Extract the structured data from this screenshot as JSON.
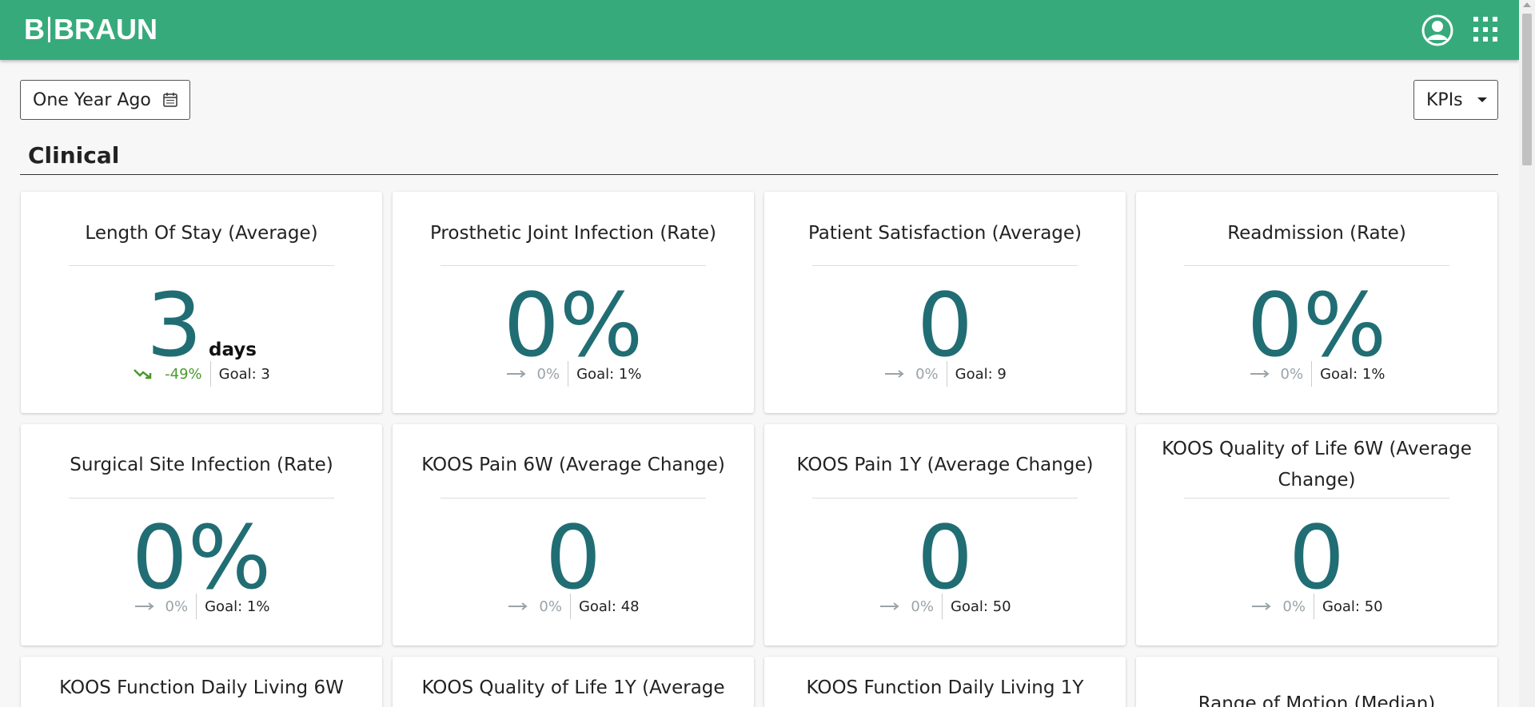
{
  "header": {
    "brand": "B|BRAUN",
    "brand_left": "B",
    "brand_right": "BRAUN"
  },
  "toolbar": {
    "date_range_label": "One Year Ago",
    "view_select_label": "KPIs"
  },
  "section": {
    "title": "Clinical"
  },
  "colors": {
    "header_bg": "#37aa7b",
    "value_color": "#216d74",
    "trend_down": "#4a9a2d",
    "trend_flat": "#9aa3a8"
  },
  "cards": [
    {
      "title": "Length Of Stay (Average)",
      "value": "3",
      "unit": "days",
      "trend_icon": "trend-down-icon",
      "trend_pct": "-49%",
      "goal": "Goal: 3"
    },
    {
      "title": "Prosthetic Joint Infection (Rate)",
      "value": "0%",
      "unit": "",
      "trend_icon": "arrow-right-icon",
      "trend_pct": "0%",
      "goal": "Goal: 1%"
    },
    {
      "title": "Patient Satisfaction (Average)",
      "value": "0",
      "unit": "",
      "trend_icon": "arrow-right-icon",
      "trend_pct": "0%",
      "goal": "Goal: 9"
    },
    {
      "title": "Readmission (Rate)",
      "value": "0%",
      "unit": "",
      "trend_icon": "arrow-right-icon",
      "trend_pct": "0%",
      "goal": "Goal: 1%"
    },
    {
      "title": "Surgical Site Infection (Rate)",
      "value": "0%",
      "unit": "",
      "trend_icon": "arrow-right-icon",
      "trend_pct": "0%",
      "goal": "Goal: 1%"
    },
    {
      "title": "KOOS Pain 6W (Average Change)",
      "value": "0",
      "unit": "",
      "trend_icon": "arrow-right-icon",
      "trend_pct": "0%",
      "goal": "Goal: 48"
    },
    {
      "title": "KOOS Pain 1Y (Average Change)",
      "value": "0",
      "unit": "",
      "trend_icon": "arrow-right-icon",
      "trend_pct": "0%",
      "goal": "Goal: 50"
    },
    {
      "title_line1": "KOOS Quality of Life 6W (Average",
      "title_line2": "Change)",
      "value": "0",
      "unit": "",
      "trend_icon": "arrow-right-icon",
      "trend_pct": "0%",
      "goal": "Goal: 50"
    },
    {
      "title": "KOOS Function Daily Living 6W"
    },
    {
      "title": "KOOS Quality of Life 1Y (Average"
    },
    {
      "title": "KOOS Function Daily Living 1Y"
    },
    {
      "title": "Range of Motion (Median)"
    }
  ]
}
